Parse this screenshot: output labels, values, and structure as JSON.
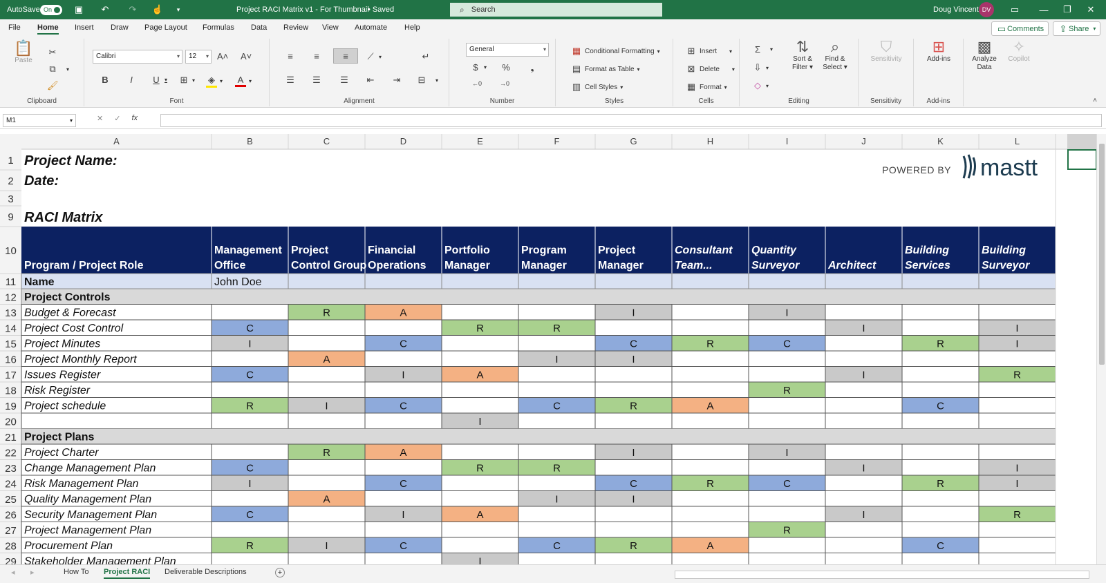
{
  "titlebar": {
    "autosave_label": "AutoSave",
    "autosave_state": "On",
    "document_title": "Project RACI Matrix v1 - For Thumbnail",
    "save_status": "• Saved",
    "search_placeholder": "Search",
    "user_name": "Doug Vincent",
    "user_initials": "DV"
  },
  "menu": {
    "items": [
      "File",
      "Home",
      "Insert",
      "Draw",
      "Page Layout",
      "Formulas",
      "Data",
      "Review",
      "View",
      "Automate",
      "Help"
    ],
    "active": "Home",
    "comments_label": "Comments",
    "share_label": "Share"
  },
  "ribbon": {
    "clipboard": {
      "label": "Clipboard",
      "paste": "Paste"
    },
    "font": {
      "label": "Font",
      "font_name": "Calibri",
      "font_size": "12"
    },
    "alignment": {
      "label": "Alignment"
    },
    "number": {
      "label": "Number",
      "format": "General"
    },
    "styles": {
      "label": "Styles",
      "conditional": "Conditional Formatting",
      "format_table": "Format as Table",
      "cell_styles": "Cell Styles"
    },
    "cells": {
      "label": "Cells",
      "insert": "Insert",
      "delete": "Delete",
      "format": "Format"
    },
    "editing": {
      "label": "Editing",
      "sort_filter_1": "Sort &",
      "sort_filter_2": "Filter",
      "find_select_1": "Find &",
      "find_select_2": "Select"
    },
    "sensitivity": {
      "label": "Sensitivity",
      "button": "Sensitivity"
    },
    "addins": {
      "label": "Add-ins",
      "button": "Add-ins"
    },
    "analyze": {
      "button_1": "Analyze",
      "button_2": "Data"
    },
    "copilot": {
      "button": "Copilot"
    }
  },
  "formula_bar": {
    "name_box": "M1",
    "formula": ""
  },
  "sheet": {
    "columns": [
      "A",
      "B",
      "C",
      "D",
      "E",
      "F",
      "G",
      "H",
      "I",
      "J",
      "K",
      "L"
    ],
    "project_name_label": "Project Name:",
    "date_label": "Date:",
    "matrix_title": "RACI Matrix",
    "powered_by": "POWERED BY",
    "brand": "mastt",
    "header_row_label": "Program / Project Role",
    "roles": [
      [
        "Management",
        "Office"
      ],
      [
        "Project",
        "Control Group"
      ],
      [
        "Financial",
        "Operations"
      ],
      [
        "Portfolio",
        "Manager"
      ],
      [
        "Program",
        "Manager"
      ],
      [
        "Project",
        "Manager"
      ],
      [
        "Consultant",
        "Team..."
      ],
      [
        "Quantity",
        "Surveyor"
      ],
      [
        "",
        "Architect"
      ],
      [
        "Building",
        "Services"
      ],
      [
        "Building",
        "Surveyor"
      ]
    ],
    "roles_italic": [
      false,
      false,
      false,
      false,
      false,
      false,
      true,
      true,
      true,
      true,
      true
    ],
    "name_label": "Name",
    "names": [
      "John Doe",
      "",
      "",
      "",
      "",
      "",
      "",
      "",
      "",
      "",
      ""
    ],
    "rows": [
      {
        "num": "12",
        "type": "section",
        "label": "Project Controls"
      },
      {
        "num": "13",
        "label": "Budget & Forecast",
        "cells": [
          "",
          "R",
          "A",
          "",
          "",
          "I",
          "",
          "I",
          "",
          "",
          ""
        ]
      },
      {
        "num": "14",
        "label": "Project Cost Control",
        "cells": [
          "C",
          "",
          "",
          "R",
          "R",
          "",
          "",
          "",
          "I",
          "",
          "I"
        ]
      },
      {
        "num": "15",
        "label": "Project Minutes",
        "cells": [
          "I",
          "",
          "C",
          "",
          "",
          "C",
          "R",
          "C",
          "",
          "R",
          "I"
        ]
      },
      {
        "num": "16",
        "label": "Project Monthly Report",
        "cells": [
          "",
          "A",
          "",
          "",
          "I",
          "I",
          "",
          "",
          "",
          "",
          ""
        ]
      },
      {
        "num": "17",
        "label": "Issues Register",
        "cells": [
          "C",
          "",
          "I",
          "A",
          "",
          "",
          "",
          "",
          "I",
          "",
          "R"
        ]
      },
      {
        "num": "18",
        "label": "Risk Register",
        "cells": [
          "",
          "",
          "",
          "",
          "",
          "",
          "",
          "R",
          "",
          "",
          ""
        ]
      },
      {
        "num": "19",
        "label": "Project schedule",
        "cells": [
          "R",
          "I",
          "C",
          "",
          "C",
          "R",
          "A",
          "",
          "",
          "C",
          ""
        ]
      },
      {
        "num": "20",
        "label": "",
        "cells": [
          "",
          "",
          "",
          "I",
          "",
          "",
          "",
          "",
          "",
          "",
          ""
        ]
      },
      {
        "num": "21",
        "type": "section",
        "label": "Project Plans"
      },
      {
        "num": "22",
        "label": "Project Charter",
        "cells": [
          "",
          "R",
          "A",
          "",
          "",
          "I",
          "",
          "I",
          "",
          "",
          ""
        ]
      },
      {
        "num": "23",
        "label": "Change Management Plan",
        "cells": [
          "C",
          "",
          "",
          "R",
          "R",
          "",
          "",
          "",
          "I",
          "",
          "I"
        ]
      },
      {
        "num": "24",
        "label": "Risk Management Plan",
        "cells": [
          "I",
          "",
          "C",
          "",
          "",
          "C",
          "R",
          "C",
          "",
          "R",
          "I"
        ]
      },
      {
        "num": "25",
        "label": "Quality Management Plan",
        "cells": [
          "",
          "A",
          "",
          "",
          "I",
          "I",
          "",
          "",
          "",
          "",
          ""
        ]
      },
      {
        "num": "26",
        "label": "Security Management Plan",
        "cells": [
          "C",
          "",
          "I",
          "A",
          "",
          "",
          "",
          "",
          "I",
          "",
          "R"
        ]
      },
      {
        "num": "27",
        "label": "Project Management Plan",
        "cells": [
          "",
          "",
          "",
          "",
          "",
          "",
          "",
          "R",
          "",
          "",
          ""
        ]
      },
      {
        "num": "28",
        "label": "Procurement Plan",
        "cells": [
          "R",
          "I",
          "C",
          "",
          "C",
          "R",
          "A",
          "",
          "",
          "C",
          ""
        ]
      },
      {
        "num": "29",
        "label": "Stakeholder Management Plan",
        "cells": [
          "",
          "",
          "",
          "I",
          "",
          "",
          "",
          "",
          "",
          "",
          ""
        ]
      }
    ],
    "raci_colors": {
      "R": "#a9d18e",
      "A": "#f4b183",
      "C": "#8eaadb",
      "I": "#c9c9c9"
    },
    "header_color": "#0c2161",
    "name_row_color": "#d9e1f2",
    "section_color": "#d9d9d9"
  },
  "tabs": {
    "items": [
      "How To",
      "Project RACI",
      "Deliverable Descriptions"
    ],
    "active": "Project RACI",
    "add_label": "+"
  }
}
